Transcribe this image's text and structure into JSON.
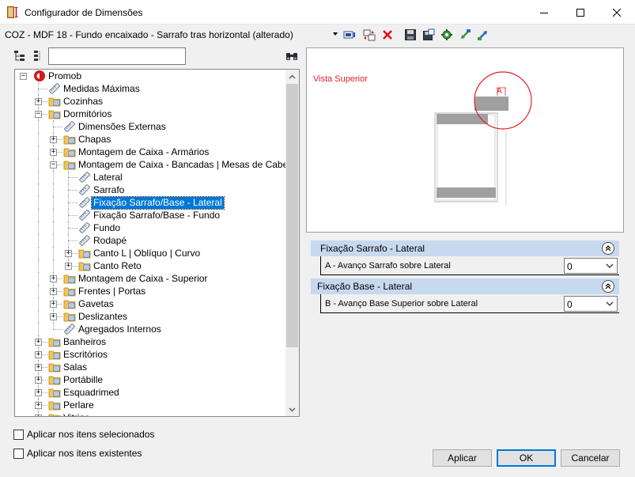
{
  "window": {
    "title": "Configurador de Dimensões"
  },
  "config": {
    "name": "COZ - MDF 18 - Fundo encaixado - Sarrafo tras horizontal (alterado)"
  },
  "toolbar_icons": [
    "select-item-icon",
    "refresh-icon",
    "delete-icon",
    "save-icon",
    "save-as-icon",
    "settings-icon",
    "import-icon",
    "export-icon"
  ],
  "search": {
    "value": ""
  },
  "tree": [
    {
      "label": "Promob",
      "depth": 0,
      "expander": "minus",
      "icon": "promob-logo-icon"
    },
    {
      "label": "Medidas Máximas",
      "depth": 1,
      "expander": "",
      "icon": "ruler-icon"
    },
    {
      "label": "Cozinhas",
      "depth": 1,
      "expander": "plus",
      "icon": "folder-icon"
    },
    {
      "label": "Dormitórios",
      "depth": 1,
      "expander": "minus",
      "icon": "folder-icon"
    },
    {
      "label": "Dimensões Externas",
      "depth": 2,
      "expander": "",
      "icon": "ruler-icon"
    },
    {
      "label": "Chapas",
      "depth": 2,
      "expander": "plus",
      "icon": "folder-icon"
    },
    {
      "label": "Montagem de Caixa - Armários",
      "depth": 2,
      "expander": "plus",
      "icon": "folder-icon"
    },
    {
      "label": "Montagem de Caixa - Bancadas | Mesas de Cabeceira",
      "depth": 2,
      "expander": "minus",
      "icon": "folder-icon"
    },
    {
      "label": "Lateral",
      "depth": 3,
      "expander": "",
      "icon": "ruler-icon"
    },
    {
      "label": "Sarrafo",
      "depth": 3,
      "expander": "",
      "icon": "ruler-icon"
    },
    {
      "label": "Fixação Sarrafo/Base - Lateral",
      "depth": 3,
      "expander": "",
      "icon": "ruler-icon",
      "selected": true
    },
    {
      "label": "Fixação Sarrafo/Base - Fundo",
      "depth": 3,
      "expander": "",
      "icon": "ruler-icon"
    },
    {
      "label": "Fundo",
      "depth": 3,
      "expander": "",
      "icon": "ruler-icon"
    },
    {
      "label": "Rodapé",
      "depth": 3,
      "expander": "",
      "icon": "ruler-icon"
    },
    {
      "label": "Canto L | Oblíquo | Curvo",
      "depth": 3,
      "expander": "plus",
      "icon": "folder-icon"
    },
    {
      "label": "Canto Reto",
      "depth": 3,
      "expander": "plus",
      "icon": "folder-icon"
    },
    {
      "label": "Montagem de Caixa - Superior",
      "depth": 2,
      "expander": "plus",
      "icon": "folder-icon"
    },
    {
      "label": "Frentes | Portas",
      "depth": 2,
      "expander": "plus",
      "icon": "folder-icon"
    },
    {
      "label": "Gavetas",
      "depth": 2,
      "expander": "plus",
      "icon": "folder-icon"
    },
    {
      "label": "Deslizantes",
      "depth": 2,
      "expander": "plus",
      "icon": "folder-icon"
    },
    {
      "label": "Agregados Internos",
      "depth": 2,
      "expander": "",
      "icon": "ruler-icon"
    },
    {
      "label": "Banheiros",
      "depth": 1,
      "expander": "plus",
      "icon": "folder-icon"
    },
    {
      "label": "Escritórios",
      "depth": 1,
      "expander": "plus",
      "icon": "folder-icon"
    },
    {
      "label": "Salas",
      "depth": 1,
      "expander": "plus",
      "icon": "folder-icon"
    },
    {
      "label": "Portábille",
      "depth": 1,
      "expander": "plus",
      "icon": "folder-icon"
    },
    {
      "label": "Esquadrimed",
      "depth": 1,
      "expander": "plus",
      "icon": "folder-icon"
    },
    {
      "label": "Perlare",
      "depth": 1,
      "expander": "plus",
      "icon": "folder-icon"
    },
    {
      "label": "Vitrine",
      "depth": 1,
      "expander": "plus",
      "icon": "folder-icon"
    }
  ],
  "preview": {
    "label": "Vista Superior",
    "marker": "A"
  },
  "sections": [
    {
      "title": "Fixação Sarrafo - Lateral",
      "property": {
        "label": "A - Avanço Sarrafo sobre Lateral",
        "value": "0"
      }
    },
    {
      "title": "Fixação Base - Lateral",
      "property": {
        "label": "B - Avanço Base Superior sobre Lateral",
        "value": "0"
      }
    }
  ],
  "options": {
    "apply_selected": "Aplicar nos itens selecionados",
    "apply_existing": "Aplicar nos itens existentes"
  },
  "buttons": {
    "apply": "Aplicar",
    "ok": "OK",
    "cancel": "Cancelar"
  },
  "colors": {
    "selection": "#0078d7",
    "section_header": "#c7d9ef",
    "preview_accent": "#e0202a",
    "folder": "#f2c45a"
  }
}
